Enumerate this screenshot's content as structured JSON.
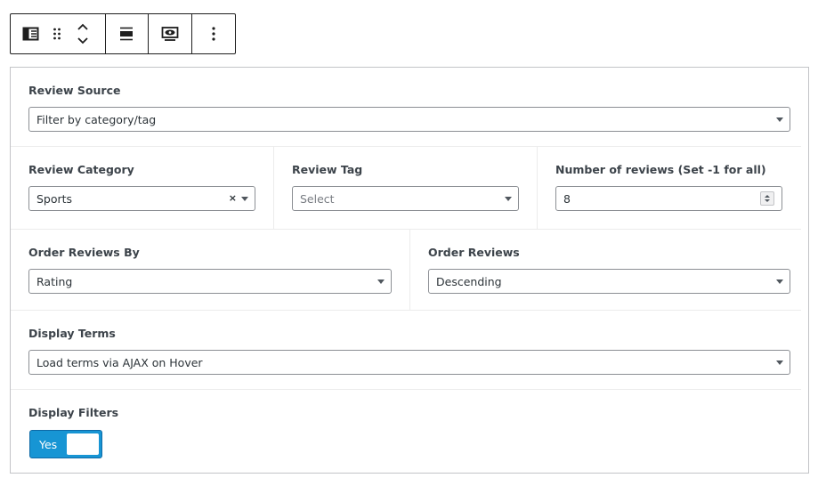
{
  "toolbar": {
    "buttons": [
      "block-parent-icon",
      "drag-handle-icon",
      "move-up-down-icon",
      "align-icon",
      "preview-eye-icon",
      "more-options-icon"
    ]
  },
  "fields": {
    "review_source": {
      "label": "Review Source",
      "value": "Filter by category/tag"
    },
    "review_category": {
      "label": "Review Category",
      "value": "Sports",
      "clear": "×"
    },
    "review_tag": {
      "label": "Review Tag",
      "placeholder": "Select"
    },
    "num_reviews": {
      "label": "Number of reviews (Set -1 for all)",
      "value": "8"
    },
    "order_by": {
      "label": "Order Reviews By",
      "value": "Rating"
    },
    "order": {
      "label": "Order Reviews",
      "value": "Descending"
    },
    "display_terms": {
      "label": "Display Terms",
      "value": "Load terms via AJAX on Hover"
    },
    "display_filters": {
      "label": "Display Filters",
      "toggle_text": "Yes",
      "enabled": true
    }
  },
  "colors": {
    "toggle_on": "#1795d4",
    "border": "#8c8f94"
  }
}
